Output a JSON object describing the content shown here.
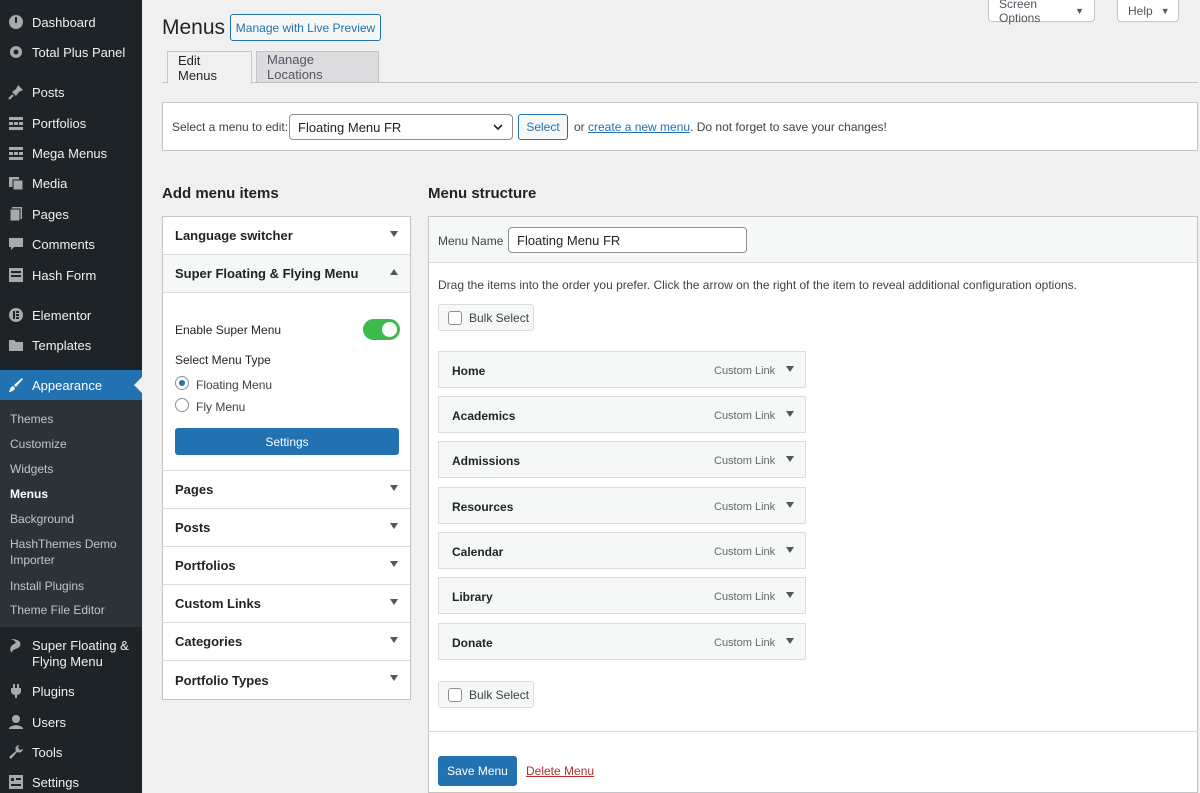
{
  "sidebar": {
    "items": [
      {
        "label": "Dashboard",
        "icon": "dashboard-icon"
      },
      {
        "label": "Total Plus Panel",
        "icon": "gear-icon"
      },
      {
        "label": "Posts",
        "icon": "pin-icon"
      },
      {
        "label": "Portfolios",
        "icon": "grid-icon"
      },
      {
        "label": "Mega Menus",
        "icon": "grid-icon"
      },
      {
        "label": "Media",
        "icon": "media-icon"
      },
      {
        "label": "Pages",
        "icon": "page-icon"
      },
      {
        "label": "Comments",
        "icon": "comment-icon"
      },
      {
        "label": "Hash Form",
        "icon": "form-icon"
      },
      {
        "label": "Elementor",
        "icon": "elementor-icon"
      },
      {
        "label": "Templates",
        "icon": "folder-icon"
      },
      {
        "label": "Appearance",
        "icon": "brush-icon"
      },
      {
        "label": "Super Floating & Flying Menu",
        "icon": "menu-plugin-icon"
      },
      {
        "label": "Plugins",
        "icon": "plug-icon"
      },
      {
        "label": "Users",
        "icon": "user-icon"
      },
      {
        "label": "Tools",
        "icon": "wrench-icon"
      },
      {
        "label": "Settings",
        "icon": "settings-icon"
      }
    ],
    "submenu": [
      "Themes",
      "Customize",
      "Widgets",
      "Menus",
      "Background",
      "HashThemes Demo Importer",
      "Install Plugins",
      "Theme File Editor"
    ]
  },
  "header": {
    "title": "Menus",
    "live_preview": "Manage with Live Preview",
    "screen_options": "Screen Options",
    "help": "Help"
  },
  "tabs": [
    "Edit Menus",
    "Manage Locations"
  ],
  "select_menu": {
    "label": "Select a menu to edit:",
    "selected": "Floating Menu FR",
    "button": "Select",
    "or": "or",
    "create_link": "create a new menu",
    "reminder": ". Do not forget to save your changes!"
  },
  "add_items": {
    "title": "Add menu items",
    "panels": [
      "Language switcher",
      "Super Floating & Flying Menu",
      "Pages",
      "Posts",
      "Portfolios",
      "Custom Links",
      "Categories",
      "Portfolio Types"
    ],
    "enable_label": "Enable Super Menu",
    "enable_on": true,
    "type_label": "Select Menu Type",
    "types": [
      "Floating Menu",
      "Fly Menu"
    ],
    "selected_type": "Floating Menu",
    "settings_button": "Settings"
  },
  "structure": {
    "title": "Menu structure",
    "name_label": "Menu Name",
    "name_value": "Floating Menu FR",
    "instructions": "Drag the items into the order you prefer. Click the arrow on the right of the item to reveal additional configuration options.",
    "bulk_select": "Bulk Select",
    "items": [
      {
        "name": "Home",
        "type": "Custom Link"
      },
      {
        "name": "Academics",
        "type": "Custom Link"
      },
      {
        "name": "Admissions",
        "type": "Custom Link"
      },
      {
        "name": "Resources",
        "type": "Custom Link"
      },
      {
        "name": "Calendar",
        "type": "Custom Link"
      },
      {
        "name": "Library",
        "type": "Custom Link"
      },
      {
        "name": "Donate",
        "type": "Custom Link"
      }
    ],
    "save_button": "Save Menu",
    "delete_link": "Delete Menu"
  },
  "colors": {
    "sidebar_bg": "#1d2327",
    "accent": "#2271b1",
    "toggle_on": "#3bbb4e",
    "delete": "#b32d2e"
  }
}
